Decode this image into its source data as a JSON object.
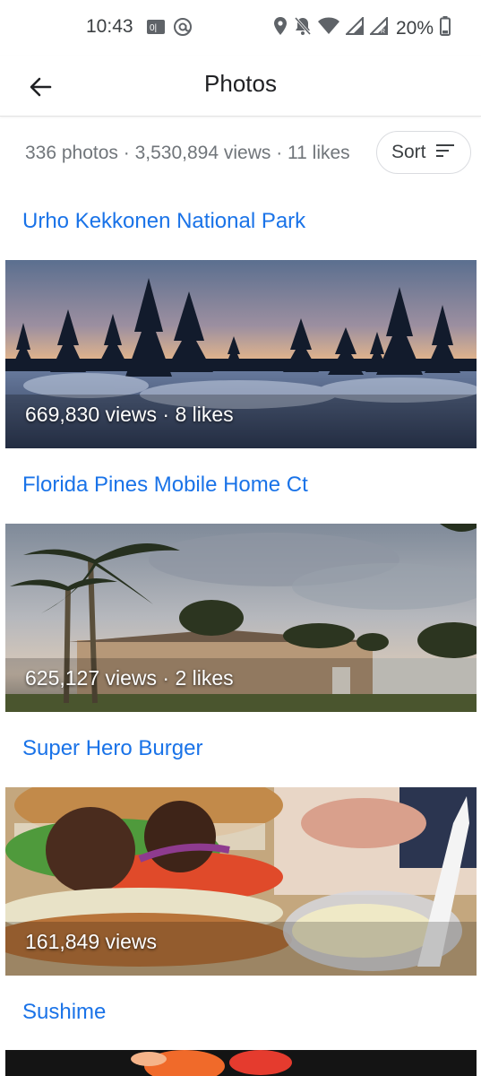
{
  "status_bar": {
    "time": "10:43",
    "battery": "20%",
    "icons": [
      "notification-icon",
      "at-icon",
      "location-icon",
      "mute-icon",
      "wifi-icon",
      "signal-icon",
      "signal-roaming-icon",
      "battery-icon"
    ]
  },
  "app_bar": {
    "title": "Photos",
    "back_icon": "arrow-left-icon"
  },
  "summary": {
    "text": "336 photos · 3,530,894 views · 11 likes",
    "sort_label": "Sort",
    "sort_icon": "sort-icon"
  },
  "photos": [
    {
      "place": "Urho Kekkonen National Park",
      "caption": "669,830 views · 8 likes"
    },
    {
      "place": "Florida Pines Mobile Home Ct",
      "caption": "625,127 views · 2 likes"
    },
    {
      "place": "Super Hero Burger",
      "caption": "161,849 views"
    },
    {
      "place": "Sushime",
      "caption": ""
    }
  ],
  "colors": {
    "link": "#1a73e8",
    "secondary_text": "#70757a",
    "divider": "#dadce0"
  }
}
